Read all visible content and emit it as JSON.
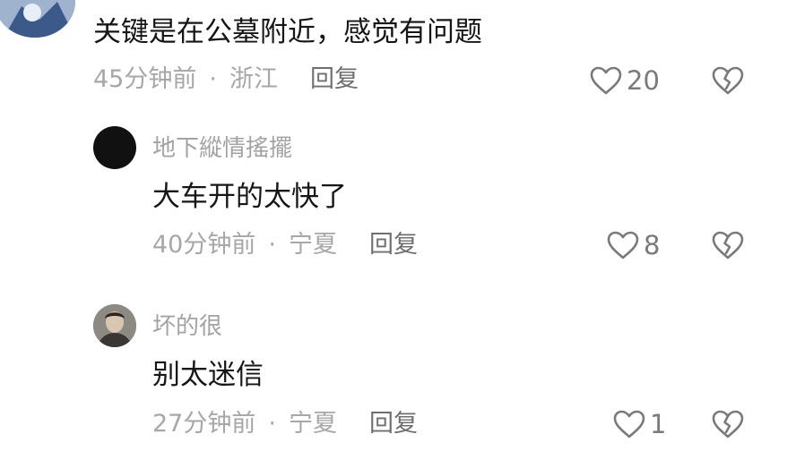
{
  "comments": [
    {
      "text": "关键是在公墓附近，感觉有问题",
      "time": "45分钟前",
      "location": "浙江",
      "reply_label": "回复",
      "likes": "20"
    },
    {
      "username": "地下縱情搖擺",
      "text": "大车开的太快了",
      "time": "40分钟前",
      "location": "宁夏",
      "reply_label": "回复",
      "likes": "8"
    },
    {
      "username": "坏的很",
      "text": "别太迷信",
      "time": "27分钟前",
      "location": "宁夏",
      "reply_label": "回复",
      "likes": "1"
    }
  ],
  "separator": "·",
  "icons": {
    "like": "heart-outline-icon",
    "dislike": "broken-heart-icon"
  },
  "colors": {
    "text": "#161616",
    "muted": "#a7a7a7",
    "reply": "#6f6f6f",
    "icon": "#7a7a7a"
  }
}
